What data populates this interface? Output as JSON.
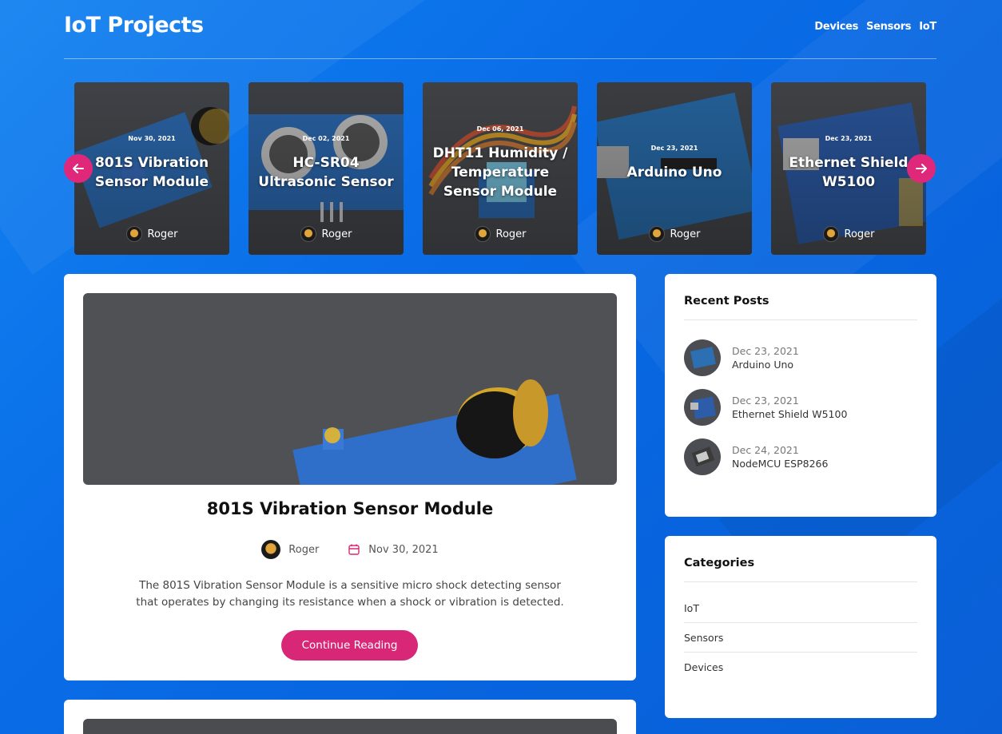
{
  "header": {
    "site_title": "IoT Projects",
    "nav": [
      "Devices",
      "Sensors",
      "IoT"
    ]
  },
  "carousel": {
    "slides": [
      {
        "date": "Nov 30, 2021",
        "title": "801S Vibration Sensor Module",
        "author": "Roger"
      },
      {
        "date": "Dec 02, 2021",
        "title": "HC-SR04 Ultrasonic Sensor",
        "author": "Roger"
      },
      {
        "date": "Dec 06, 2021",
        "title": "DHT11 Humidity / Temperature Sensor Module",
        "author": "Roger"
      },
      {
        "date": "Dec 23, 2021",
        "title": "Arduino Uno",
        "author": "Roger"
      },
      {
        "date": "Dec 23, 2021",
        "title": "Ethernet Shield W5100",
        "author": "Roger"
      }
    ],
    "prev_icon": "arrow-left-icon",
    "next_icon": "arrow-right-icon"
  },
  "post": {
    "title": "801S Vibration Sensor Module",
    "author": "Roger",
    "date": "Nov 30, 2021",
    "excerpt": "The 801S Vibration Sensor Module is a sensitive micro shock detecting sensor that operates by changing its resistance when a shock or vibration is detected.",
    "button": "Continue Reading"
  },
  "recent_posts": {
    "title": "Recent Posts",
    "items": [
      {
        "date": "Dec 23, 2021",
        "name": "Arduino Uno"
      },
      {
        "date": "Dec 23, 2021",
        "name": "Ethernet Shield W5100"
      },
      {
        "date": "Dec 24, 2021",
        "name": "NodeMCU ESP8266"
      }
    ]
  },
  "categories": {
    "title": "Categories",
    "items": [
      "IoT",
      "Sensors",
      "Devices"
    ]
  },
  "colors": {
    "accent": "#d92777",
    "background": "#0a6ee8"
  }
}
